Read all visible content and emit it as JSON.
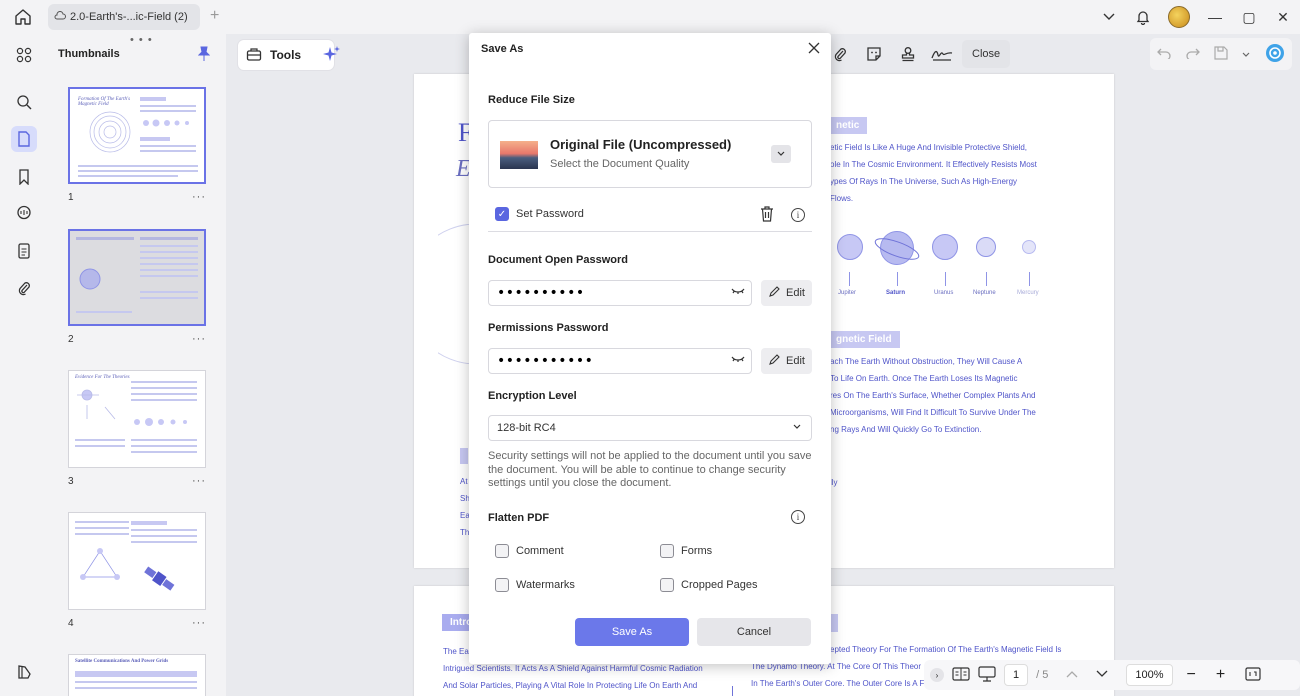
{
  "titlebar": {
    "tab_label": "2.0-Earth's-...ic-Field (2)",
    "add_tab": "+",
    "close_label": "✕",
    "maximize_label": "▢",
    "minimize_label": "—"
  },
  "thumbnails": {
    "header": "Thumbnails",
    "pages": [
      {
        "number": "1",
        "title": "Formation Of The Earth's Magnetic Field"
      },
      {
        "number": "2",
        "title": ""
      },
      {
        "number": "3",
        "title": "Evidence For The Theories"
      },
      {
        "number": "4",
        "title": ""
      },
      {
        "number": "",
        "title": "Satellite Communications And Power Grids"
      }
    ],
    "more": "···"
  },
  "toolbar": {
    "tools_label": "Tools",
    "close_label": "Close"
  },
  "document": {
    "p1_right_heading": "netic",
    "p1_right_lines": [
      "etic Field Is Like A Huge And Invisible Protective Shield,",
      "ole In The Cosmic Environment. It Effectively Resists Most",
      "ypes Of Rays In The Universe, Such As High-Energy",
      "Flows."
    ],
    "planets": [
      "Jupiter",
      "Saturn",
      "Uranus",
      "Neptune",
      "Mercury"
    ],
    "p1_right_heading2": "gnetic Field",
    "p1_right_lines2": [
      "ach The Earth Without Obstruction, They Will Cause A",
      "To Life On Earth. Once The Earth Loses Its Magnetic",
      "res On The Earth's Surface, Whether Complex Plants And",
      "Microorganisms, Will Find It Difficult To Survive Under The",
      "ng Rays And Will Quickly Go To Extinction."
    ],
    "p1_left_big": "F",
    "p1_left_italic": "E",
    "p1_left_snips": [
      "At",
      "Sh",
      "Ea",
      "Th"
    ],
    "p1_misc": "lly",
    "p2_left_heading": "Intro",
    "p2_left_lines": [
      "The Ea",
      "Intrigued Scientists. It Acts As A Shield Against Harmful Cosmic Radiation",
      "And Solar Particles, Playing A Vital Role In Protecting Life On Earth And"
    ],
    "p2_right_lines": [
      "epted Theory For The Formation Of The Earth's Magnetic Field Is",
      "The Dynamo Theory. At The Core Of This Theor",
      "In The Earth's Outer Core. The Outer Core Is A F"
    ]
  },
  "bottom_nav": {
    "page_current": "1",
    "page_total": "/ 5",
    "zoom": "100%",
    "minus": "−",
    "plus": "+"
  },
  "dialog": {
    "title": "Save As",
    "reduce_heading": "Reduce File Size",
    "quality_title": "Original File (Uncompressed)",
    "quality_sub": "Select the Document Quality",
    "set_password": "Set Password",
    "open_pw_heading": "Document Open Password",
    "open_pw_value": "••••••••••",
    "perm_pw_heading": "Permissions Password",
    "perm_pw_value": "•••••••••••",
    "edit_label": "Edit",
    "encryption_heading": "Encryption Level",
    "encryption_value": "128-bit RC4",
    "note": "Security settings will not be applied to the document until you save the document. You will be able to continue to change security settings until you close the document.",
    "flatten_heading": "Flatten PDF",
    "flatten_options": {
      "comment": "Comment",
      "forms": "Forms",
      "watermarks": "Watermarks",
      "cropped": "Cropped Pages"
    },
    "save_label": "Save As",
    "cancel_label": "Cancel"
  },
  "colors": {
    "accent": "#6b78ea",
    "doc_text": "#4f54c9"
  }
}
